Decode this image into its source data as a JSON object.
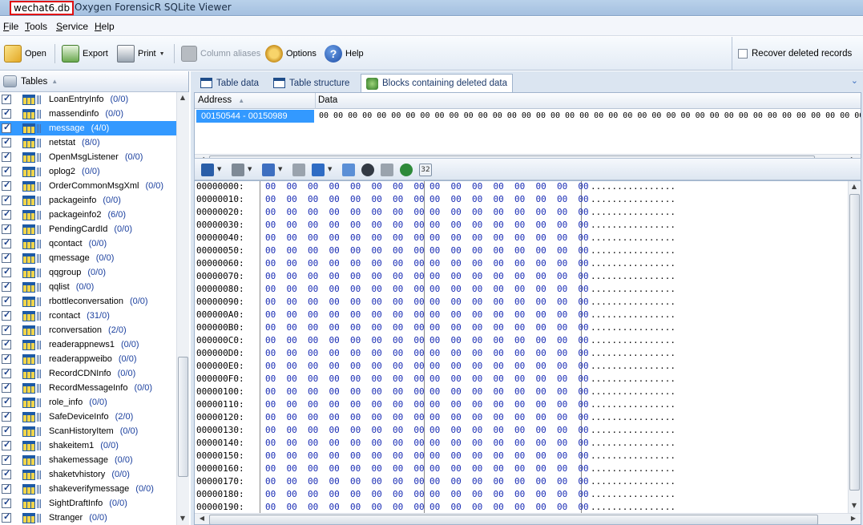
{
  "window": {
    "file": "wechat6.db",
    "app": "Oxygen ForensicR SQLite Viewer"
  },
  "menu": [
    "File",
    "Tools",
    "Service",
    "Help"
  ],
  "toolbar": {
    "open": "Open",
    "export": "Export",
    "print": "Print",
    "column_aliases": "Column aliases",
    "options": "Options",
    "help": "Help",
    "recover": "Recover deleted records"
  },
  "left": {
    "header": "Tables",
    "tables": [
      {
        "name": "LoanEntryInfo",
        "count": "(0/0)"
      },
      {
        "name": "massendinfo",
        "count": "(0/0)"
      },
      {
        "name": "message",
        "count": "(4/0)",
        "selected": true
      },
      {
        "name": "netstat",
        "count": "(8/0)"
      },
      {
        "name": "OpenMsgListener",
        "count": "(0/0)"
      },
      {
        "name": "oplog2",
        "count": "(0/0)"
      },
      {
        "name": "OrderCommonMsgXml",
        "count": "(0/0)"
      },
      {
        "name": "packageinfo",
        "count": "(0/0)"
      },
      {
        "name": "packageinfo2",
        "count": "(6/0)"
      },
      {
        "name": "PendingCardId",
        "count": "(0/0)"
      },
      {
        "name": "qcontact",
        "count": "(0/0)"
      },
      {
        "name": "qmessage",
        "count": "(0/0)"
      },
      {
        "name": "qqgroup",
        "count": "(0/0)"
      },
      {
        "name": "qqlist",
        "count": "(0/0)"
      },
      {
        "name": "rbottleconversation",
        "count": "(0/0)"
      },
      {
        "name": "rcontact",
        "count": "(31/0)"
      },
      {
        "name": "rconversation",
        "count": "(2/0)"
      },
      {
        "name": "readerappnews1",
        "count": "(0/0)"
      },
      {
        "name": "readerappweibo",
        "count": "(0/0)"
      },
      {
        "name": "RecordCDNInfo",
        "count": "(0/0)"
      },
      {
        "name": "RecordMessageInfo",
        "count": "(0/0)"
      },
      {
        "name": "role_info",
        "count": "(0/0)"
      },
      {
        "name": "SafeDeviceInfo",
        "count": "(2/0)"
      },
      {
        "name": "ScanHistoryItem",
        "count": "(0/0)"
      },
      {
        "name": "shakeitem1",
        "count": "(0/0)"
      },
      {
        "name": "shakemessage",
        "count": "(0/0)"
      },
      {
        "name": "shaketvhistory",
        "count": "(0/0)"
      },
      {
        "name": "shakeverifymessage",
        "count": "(0/0)"
      },
      {
        "name": "SightDraftInfo",
        "count": "(0/0)"
      },
      {
        "name": "Stranger",
        "count": "(0/0)"
      }
    ]
  },
  "tabs": [
    {
      "label": "Table data"
    },
    {
      "label": "Table structure"
    },
    {
      "label": "Blocks containing deleted data",
      "active": true
    }
  ],
  "grid": {
    "columns": [
      "Address",
      "Data"
    ],
    "rows": [
      {
        "address": "00150544 - 00150989",
        "data": "00 00 00 00 00 00 00 00 00 00 00 00 00 00 00 00 00 00 00 00 00 00 00 00 00 00 00 00 00 00 00 00 00 00 00 00 00 00 00 00 00 00 00 00 00 00 00 00 00 00 00 00 00 00 00 00 00 00 00 00 00 00 00 00 00 00 00 00 00 00 00 00 00 00 00 00 00 00 00 00 00 00 00 00 00 00 00 00 00 00"
      }
    ]
  },
  "hex": {
    "hextoolbar_label": "32",
    "bytes_group": "00  00  00  00  00  00  00  00",
    "ascii": "................",
    "offsets": [
      "00000000:",
      "00000010:",
      "00000020:",
      "00000030:",
      "00000040:",
      "00000050:",
      "00000060:",
      "00000070:",
      "00000080:",
      "00000090:",
      "000000A0:",
      "000000B0:",
      "000000C0:",
      "000000D0:",
      "000000E0:",
      "000000F0:",
      "00000100:",
      "00000110:",
      "00000120:",
      "00000130:",
      "00000140:",
      "00000150:",
      "00000160:",
      "00000170:",
      "00000180:",
      "00000190:"
    ]
  }
}
